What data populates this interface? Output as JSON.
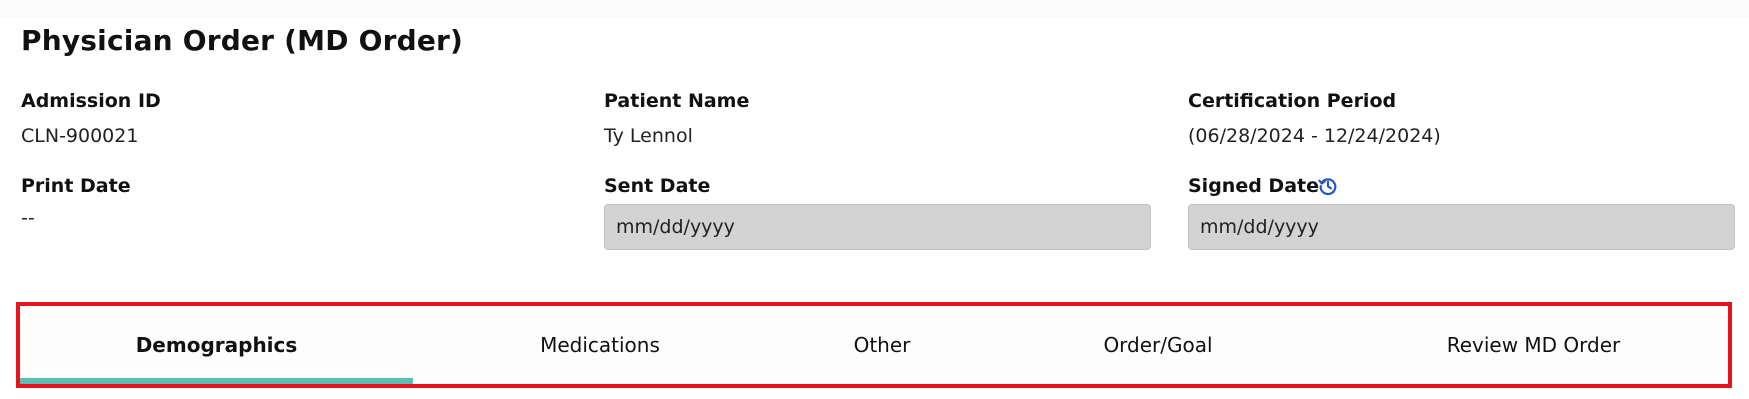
{
  "page": {
    "title": "Physician Order (MD Order)"
  },
  "fields": {
    "admission_id": {
      "label": "Admission ID",
      "value": "CLN-900021"
    },
    "patient_name": {
      "label": "Patient Name",
      "value": "Ty Lennol"
    },
    "certification_period": {
      "label": "Certification Period",
      "value": "(06/28/2024 - 12/24/2024)"
    },
    "print_date": {
      "label": "Print Date",
      "value": "--"
    },
    "sent_date": {
      "label": "Sent Date",
      "placeholder": "mm/dd/yyyy"
    },
    "signed_date": {
      "label": "Signed Date",
      "placeholder": "mm/dd/yyyy",
      "history_icon": "history-icon"
    }
  },
  "tabs": [
    {
      "label": "Demographics",
      "active": true
    },
    {
      "label": "Medications",
      "active": false
    },
    {
      "label": "Other",
      "active": false
    },
    {
      "label": "Order/Goal",
      "active": false
    },
    {
      "label": "Review MD Order",
      "active": false
    }
  ],
  "colors": {
    "highlight_border": "#e5141b",
    "active_tab_underline": "#5dbfb3",
    "icon_blue": "#2457c5",
    "input_bg": "#d3d3d3"
  }
}
